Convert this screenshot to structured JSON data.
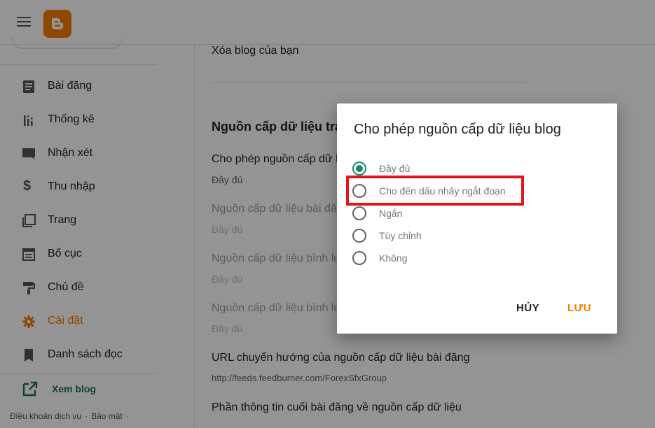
{
  "sidebar": {
    "items": [
      {
        "label": "Bài đăng",
        "icon": "posts-icon"
      },
      {
        "label": "Thống kê",
        "icon": "stats-icon"
      },
      {
        "label": "Nhận xét",
        "icon": "comments-icon"
      },
      {
        "label": "Thu nhập",
        "icon": "dollar-icon"
      },
      {
        "label": "Trang",
        "icon": "pages-icon"
      },
      {
        "label": "Bố cục",
        "icon": "layout-icon"
      },
      {
        "label": "Chủ đề",
        "icon": "paint-roller-icon"
      },
      {
        "label": "Cài đặt",
        "icon": "gear-icon"
      },
      {
        "label": "Danh sách đọc",
        "icon": "bookmark-icon"
      }
    ],
    "active_index": 7,
    "view_blog": "Xem blog",
    "footer": {
      "terms": "Điều khoản dịch vụ",
      "privacy": "Bảo mật",
      "sep": "·"
    }
  },
  "main": {
    "delete_blog": "Xóa blog của bạn",
    "section_heading": "Nguồn cấp dữ liệu tra",
    "rows": [
      {
        "title": "Cho phép nguồn cấp dữ li",
        "value": "Đầy đủ"
      },
      {
        "title": "Nguồn cấp dữ liệu bài đăng",
        "value": "Đầy đủ"
      },
      {
        "title": "Nguồn cấp dữ liệu bình lu",
        "value": "Đầy đủ"
      },
      {
        "title": "Nguồn cấp dữ liệu bình lu",
        "value": "Đầy đủ"
      }
    ],
    "redirect_title": "URL chuyển hướng của nguồn cấp dữ liệu bài đăng",
    "redirect_value": "http://feeds.feedburner.com/ForexSfxGroup",
    "footer_title": "Phần thông tin cuối bài đăng về nguồn cấp dữ liệu"
  },
  "dialog": {
    "title": "Cho phép nguồn cấp dữ liệu blog",
    "options": [
      "Đầy đủ",
      "Cho đến dấu nhảy ngắt đoạn",
      "Ngắn",
      "Tùy chỉnh",
      "Không"
    ],
    "selected_index": 0,
    "highlighted_index": 1,
    "cancel": "HỦY",
    "save": "LƯU"
  },
  "colors": {
    "accent": "#f57d00",
    "radio_checked": "#1a8a6e",
    "highlight": "#e3151a",
    "link": "#1a6e5a"
  }
}
